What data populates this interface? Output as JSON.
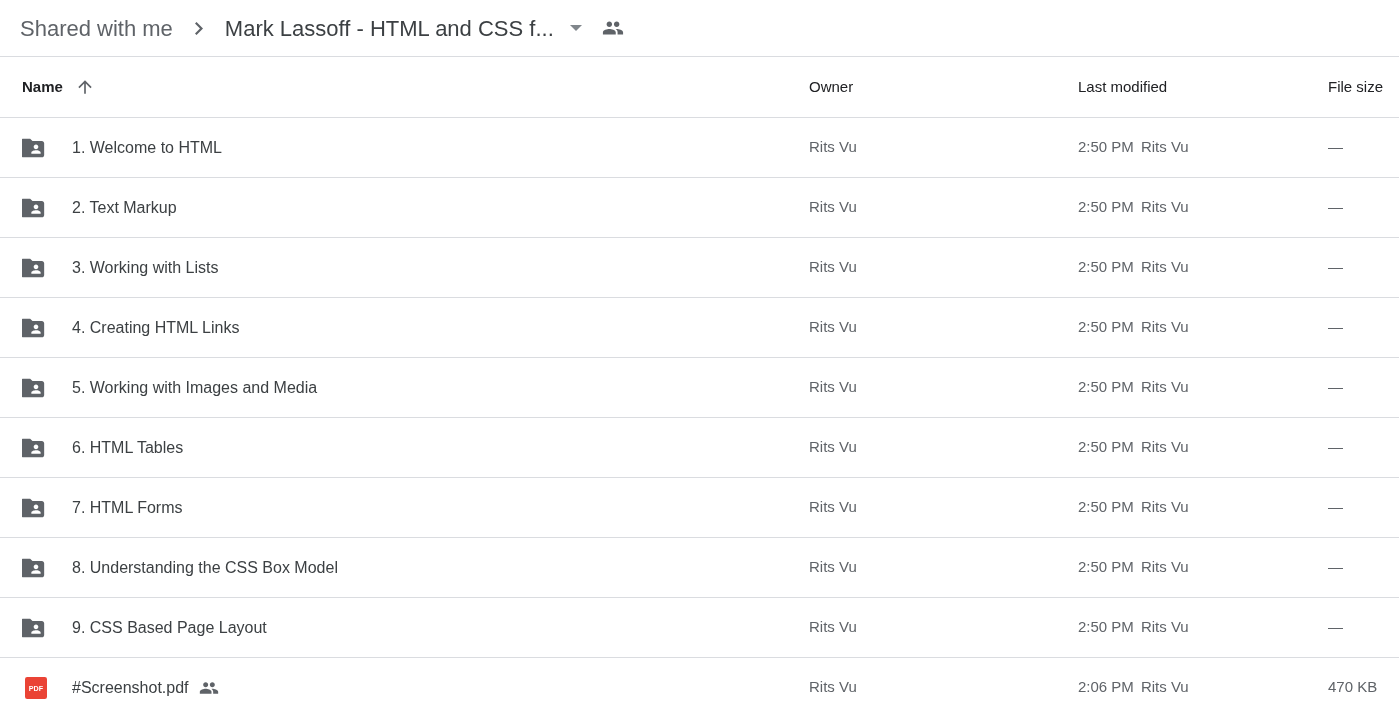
{
  "breadcrumb": {
    "parent": "Shared with me",
    "current": "Mark Lassoff - HTML and CSS f...",
    "shared": true
  },
  "table": {
    "columns": [
      {
        "label": "Name",
        "sorted": true,
        "ascending": true
      },
      {
        "label": "Owner",
        "sorted": false
      },
      {
        "label": "Last modified",
        "sorted": false
      },
      {
        "label": "File size",
        "sorted": false
      }
    ],
    "rows": [
      {
        "kind": "folder",
        "name": "1. Welcome to HTML",
        "shared": false,
        "owner": "Rits Vu",
        "modified_time": "2:50 PM",
        "modified_by": "Rits Vu",
        "size": "—"
      },
      {
        "kind": "folder",
        "name": "2. Text Markup",
        "shared": false,
        "owner": "Rits Vu",
        "modified_time": "2:50 PM",
        "modified_by": "Rits Vu",
        "size": "—"
      },
      {
        "kind": "folder",
        "name": "3. Working with Lists",
        "shared": false,
        "owner": "Rits Vu",
        "modified_time": "2:50 PM",
        "modified_by": "Rits Vu",
        "size": "—"
      },
      {
        "kind": "folder",
        "name": "4. Creating HTML Links",
        "shared": false,
        "owner": "Rits Vu",
        "modified_time": "2:50 PM",
        "modified_by": "Rits Vu",
        "size": "—"
      },
      {
        "kind": "folder",
        "name": "5. Working with Images and Media",
        "shared": false,
        "owner": "Rits Vu",
        "modified_time": "2:50 PM",
        "modified_by": "Rits Vu",
        "size": "—"
      },
      {
        "kind": "folder",
        "name": "6. HTML Tables",
        "shared": false,
        "owner": "Rits Vu",
        "modified_time": "2:50 PM",
        "modified_by": "Rits Vu",
        "size": "—"
      },
      {
        "kind": "folder",
        "name": "7. HTML Forms",
        "shared": false,
        "owner": "Rits Vu",
        "modified_time": "2:50 PM",
        "modified_by": "Rits Vu",
        "size": "—"
      },
      {
        "kind": "folder",
        "name": "8. Understanding the CSS Box Model",
        "shared": false,
        "owner": "Rits Vu",
        "modified_time": "2:50 PM",
        "modified_by": "Rits Vu",
        "size": "—"
      },
      {
        "kind": "folder",
        "name": "9. CSS Based Page Layout",
        "shared": false,
        "owner": "Rits Vu",
        "modified_time": "2:50 PM",
        "modified_by": "Rits Vu",
        "size": "—"
      },
      {
        "kind": "pdf",
        "icon_label": "PDF",
        "name": "#Screenshot.pdf",
        "shared": true,
        "owner": "Rits Vu",
        "modified_time": "2:06 PM",
        "modified_by": "Rits Vu",
        "size": "470 KB"
      }
    ]
  }
}
